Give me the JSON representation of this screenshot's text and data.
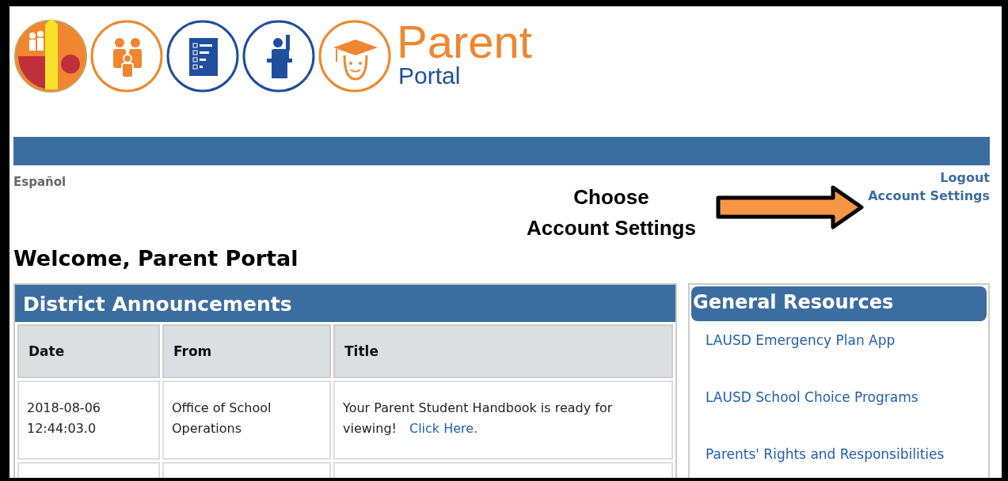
{
  "header": {
    "logo_title": "Parent",
    "logo_subtitle": "Portal"
  },
  "language_link": "Español",
  "user_links": [
    "Logout",
    "Account Settings"
  ],
  "callout": {
    "lines": [
      "Choose",
      "Account Settings"
    ]
  },
  "welcome": "Welcome, Parent Portal",
  "announcements": {
    "title": "District Announcements",
    "columns": [
      "Date",
      "From",
      "Title"
    ],
    "rows": [
      {
        "date": "2018-08-06 12:44:03.0",
        "from": "Office of School Operations",
        "title": "Your Parent Student Handbook is ready for viewing!",
        "link": "Click Here."
      }
    ]
  },
  "resources": {
    "title": "General Resources",
    "items": [
      "LAUSD Emergency Plan App",
      "LAUSD School Choice Programs",
      "Parents' Rights and Responsibilities"
    ]
  }
}
